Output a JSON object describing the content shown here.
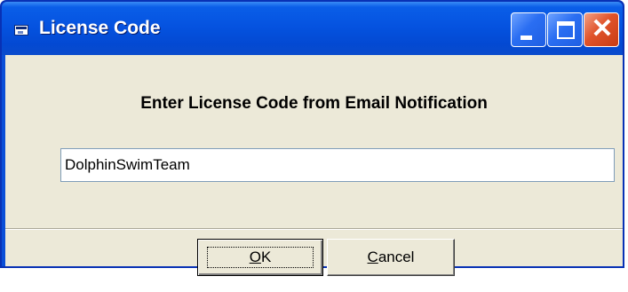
{
  "window": {
    "title": "License Code",
    "controls": {
      "minimize": "minimize",
      "maximize": "maximize",
      "close": "close"
    },
    "colors": {
      "titlebar": "#0553e0",
      "client": "#ece9d8",
      "close_button": "#e0532a"
    }
  },
  "dialog": {
    "instruction": "Enter License Code from Email Notification",
    "license_input": {
      "value": "DolphinSwimTeam",
      "placeholder": ""
    },
    "buttons": {
      "ok": {
        "accel": "O",
        "rest": "K"
      },
      "cancel": {
        "accel": "C",
        "rest": "ancel"
      }
    }
  }
}
